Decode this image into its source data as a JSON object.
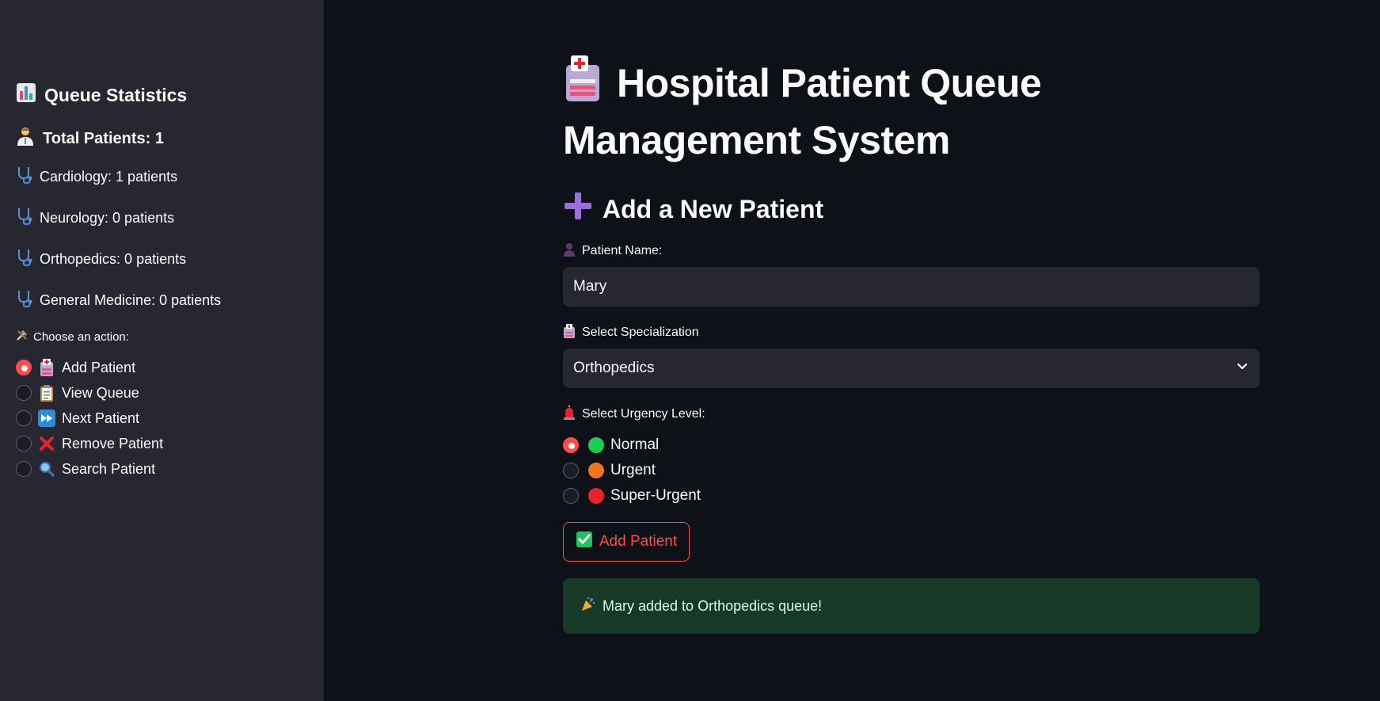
{
  "sidebar": {
    "title": "Queue Statistics",
    "total": "Total Patients: 1",
    "stats": [
      "Cardiology: 1 patients",
      "Neurology: 0 patients",
      "Orthopedics: 0 patients",
      "General Medicine: 0 patients"
    ],
    "action_label": "Choose an action:",
    "actions": [
      {
        "label": "Add Patient",
        "icon": "hospital-icon",
        "selected": true
      },
      {
        "label": "View Queue",
        "icon": "clipboard-icon",
        "selected": false
      },
      {
        "label": "Next Patient",
        "icon": "fast-forward-icon",
        "selected": false
      },
      {
        "label": "Remove Patient",
        "icon": "cross-mark-icon",
        "selected": false
      },
      {
        "label": "Search Patient",
        "icon": "magnifier-icon",
        "selected": false
      }
    ]
  },
  "main": {
    "title": "Hospital Patient Queue Management System",
    "section_title": "Add a New Patient",
    "name_label": "Patient Name:",
    "name_value": "Mary",
    "spec_label": "Select Specialization",
    "spec_value": "Orthopedics",
    "urgency_label": "Select Urgency Level:",
    "urgency": [
      {
        "label": "Normal",
        "color": "#1ecb5a",
        "selected": true
      },
      {
        "label": "Urgent",
        "color": "#f47321",
        "selected": false
      },
      {
        "label": "Super-Urgent",
        "color": "#e8232e",
        "selected": false
      }
    ],
    "button_label": "Add Patient",
    "success_message": "Mary added to Orthopedics queue!"
  },
  "colors": {
    "accent": "#ff4b4b",
    "sidebar_bg": "#262730",
    "main_bg": "#0e1117",
    "success_bg": "#173928"
  }
}
